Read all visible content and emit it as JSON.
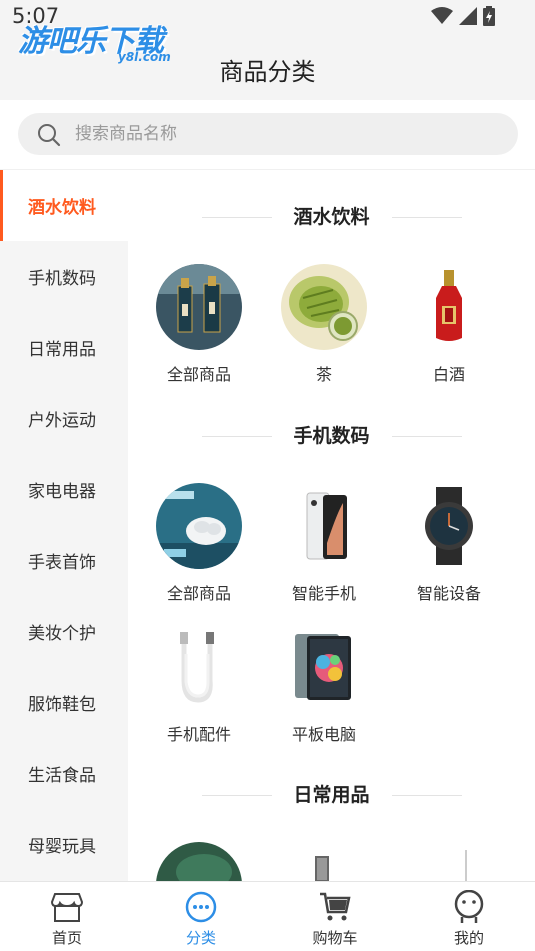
{
  "status": {
    "time": "5:07"
  },
  "logo": {
    "main": "游吧乐下载",
    "sub": "y8l.com"
  },
  "header": {
    "title": "商品分类"
  },
  "search": {
    "placeholder": "搜索商品名称"
  },
  "sidebar": {
    "active_index": 0,
    "items": [
      {
        "label": "酒水饮料"
      },
      {
        "label": "手机数码"
      },
      {
        "label": "日常用品"
      },
      {
        "label": "户外运动"
      },
      {
        "label": "家电电器"
      },
      {
        "label": "手表首饰"
      },
      {
        "label": "美妆个护"
      },
      {
        "label": "服饰鞋包"
      },
      {
        "label": "生活食品"
      },
      {
        "label": "母婴玩具"
      }
    ]
  },
  "sections": [
    {
      "title": "酒水饮料",
      "items": [
        {
          "label": "全部商品"
        },
        {
          "label": "茶"
        },
        {
          "label": "白酒"
        }
      ]
    },
    {
      "title": "手机数码",
      "items": [
        {
          "label": "全部商品"
        },
        {
          "label": "智能手机"
        },
        {
          "label": "智能设备"
        },
        {
          "label": "手机配件"
        },
        {
          "label": "平板电脑"
        }
      ]
    },
    {
      "title": "日常用品",
      "items": []
    }
  ],
  "tabbar": {
    "active_index": 1,
    "tabs": [
      {
        "label": "首页",
        "icon": "home-store-icon"
      },
      {
        "label": "分类",
        "icon": "category-icon"
      },
      {
        "label": "购物车",
        "icon": "cart-icon"
      },
      {
        "label": "我的",
        "icon": "profile-icon"
      }
    ]
  },
  "colors": {
    "accent": "#ff5a1f",
    "tab_active": "#2d8ee6",
    "sidebar_bg": "#f5f5f5"
  }
}
